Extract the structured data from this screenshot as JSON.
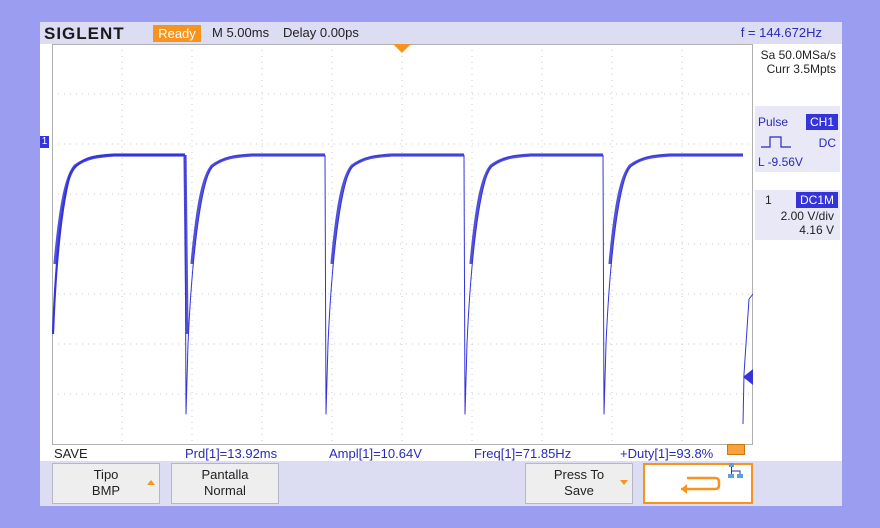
{
  "topbar": {
    "brand": "SIGLENT",
    "status": "Ready",
    "timebase": "M 5.00ms",
    "delay": "Delay 0.00ps",
    "frequency": "f = 144.672Hz"
  },
  "right_panel": {
    "sample_rate": "Sa 50.0MSa/s",
    "memory": "Curr 3.5Mpts",
    "trigger": {
      "type": "Pulse",
      "source": "CH1",
      "coupling": "DC",
      "level": "L  -9.56V"
    },
    "channel": {
      "number": "1",
      "coupling": "DC1M",
      "volts_per_div": "2.00 V/div",
      "offset": "4.16 V"
    }
  },
  "markers": {
    "channel_marker": "1"
  },
  "measurements": {
    "menu_label": "SAVE",
    "items": [
      "Prd[1]=13.92ms",
      "Ampl[1]=10.64V",
      "Freq[1]=71.85Hz",
      "+Duty[1]=93.8%"
    ]
  },
  "softkeys": {
    "type": {
      "line1": "Tipo",
      "line2": "BMP"
    },
    "display": {
      "line1": "Pantalla",
      "line2": "Normal"
    },
    "save": {
      "line1": "Press To",
      "line2": "Save"
    }
  },
  "colors": {
    "trace": "#3434d8",
    "accent": "#f7941d",
    "background": "#9b9ef0"
  }
}
